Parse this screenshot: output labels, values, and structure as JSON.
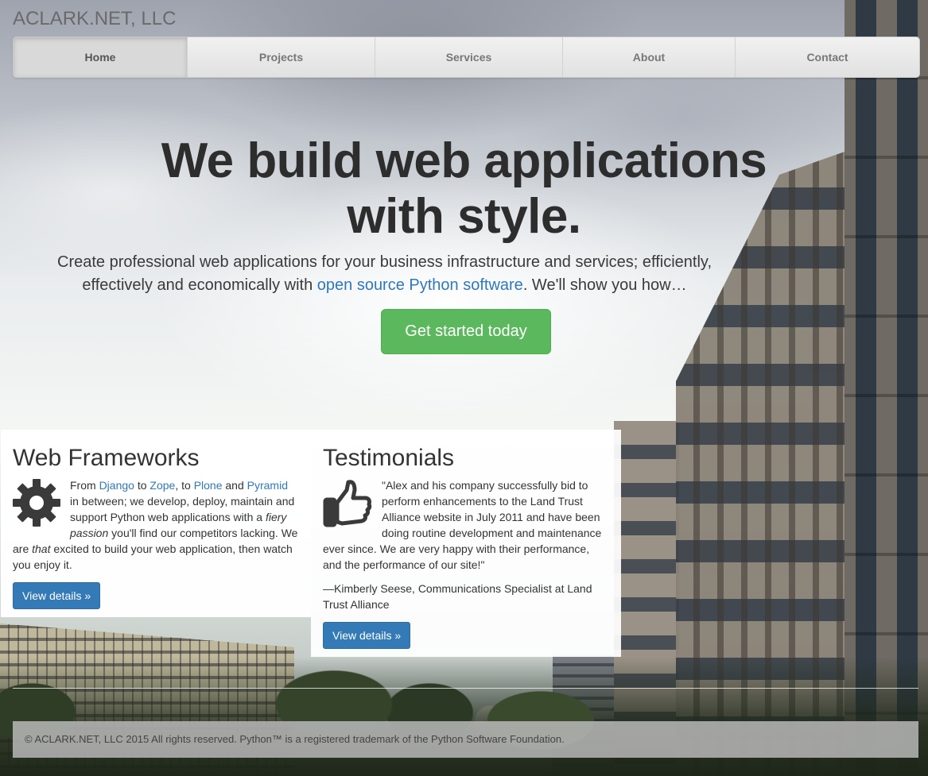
{
  "brand": "ACLARK.NET, LLC",
  "nav": {
    "items": [
      {
        "label": "Home",
        "active": true
      },
      {
        "label": "Projects"
      },
      {
        "label": "Services"
      },
      {
        "label": "About"
      },
      {
        "label": "Contact"
      }
    ]
  },
  "hero": {
    "headline_line1": "We build web applications",
    "headline_line2": "with style.",
    "lead_before": "Create professional web applications for your business infrastructure and services; efficiently, effectively and economically with ",
    "lead_link": "open source Python software",
    "lead_after": ". We'll show you how…",
    "cta_label": "Get started today"
  },
  "frameworks": {
    "title": "Web Frameworks",
    "icon": "gear-icon",
    "text_from": "From ",
    "django": "Django",
    "text_to1": " to ",
    "zope": "Zope",
    "text_to2": ", to ",
    "plone": "Plone",
    "text_and": " and ",
    "pyramid": "Pyramid",
    "text_body1": " in between; we develop, deploy, maintain and support Python web applications with a ",
    "fiery": "fiery passion",
    "text_body2": " you'll find our competitors lacking. We are ",
    "that": "that",
    "text_body3": " excited to build your web application, then watch you enjoy it.",
    "button": "View details »"
  },
  "testimonials": {
    "title": "Testimonials",
    "icon": "thumbs-up-icon",
    "quote": "\"Alex and his company successfully bid to perform enhancements to the Land Trust Alliance website in July 2011 and have been doing routine development and maintenance ever since. We are very happy with their performance, and the performance of our site!\"",
    "attribution": "—Kimberly Seese, Communications Specialist at Land Trust Alliance",
    "button": "View details »"
  },
  "footer": {
    "text": "© ACLARK.NET, LLC 2015 All rights reserved. Python™ is a registered trademark of the Python Software Foundation."
  },
  "colors": {
    "cta_green": "#5cb85c",
    "button_blue": "#337ab7",
    "link_blue": "#2f78bf"
  }
}
